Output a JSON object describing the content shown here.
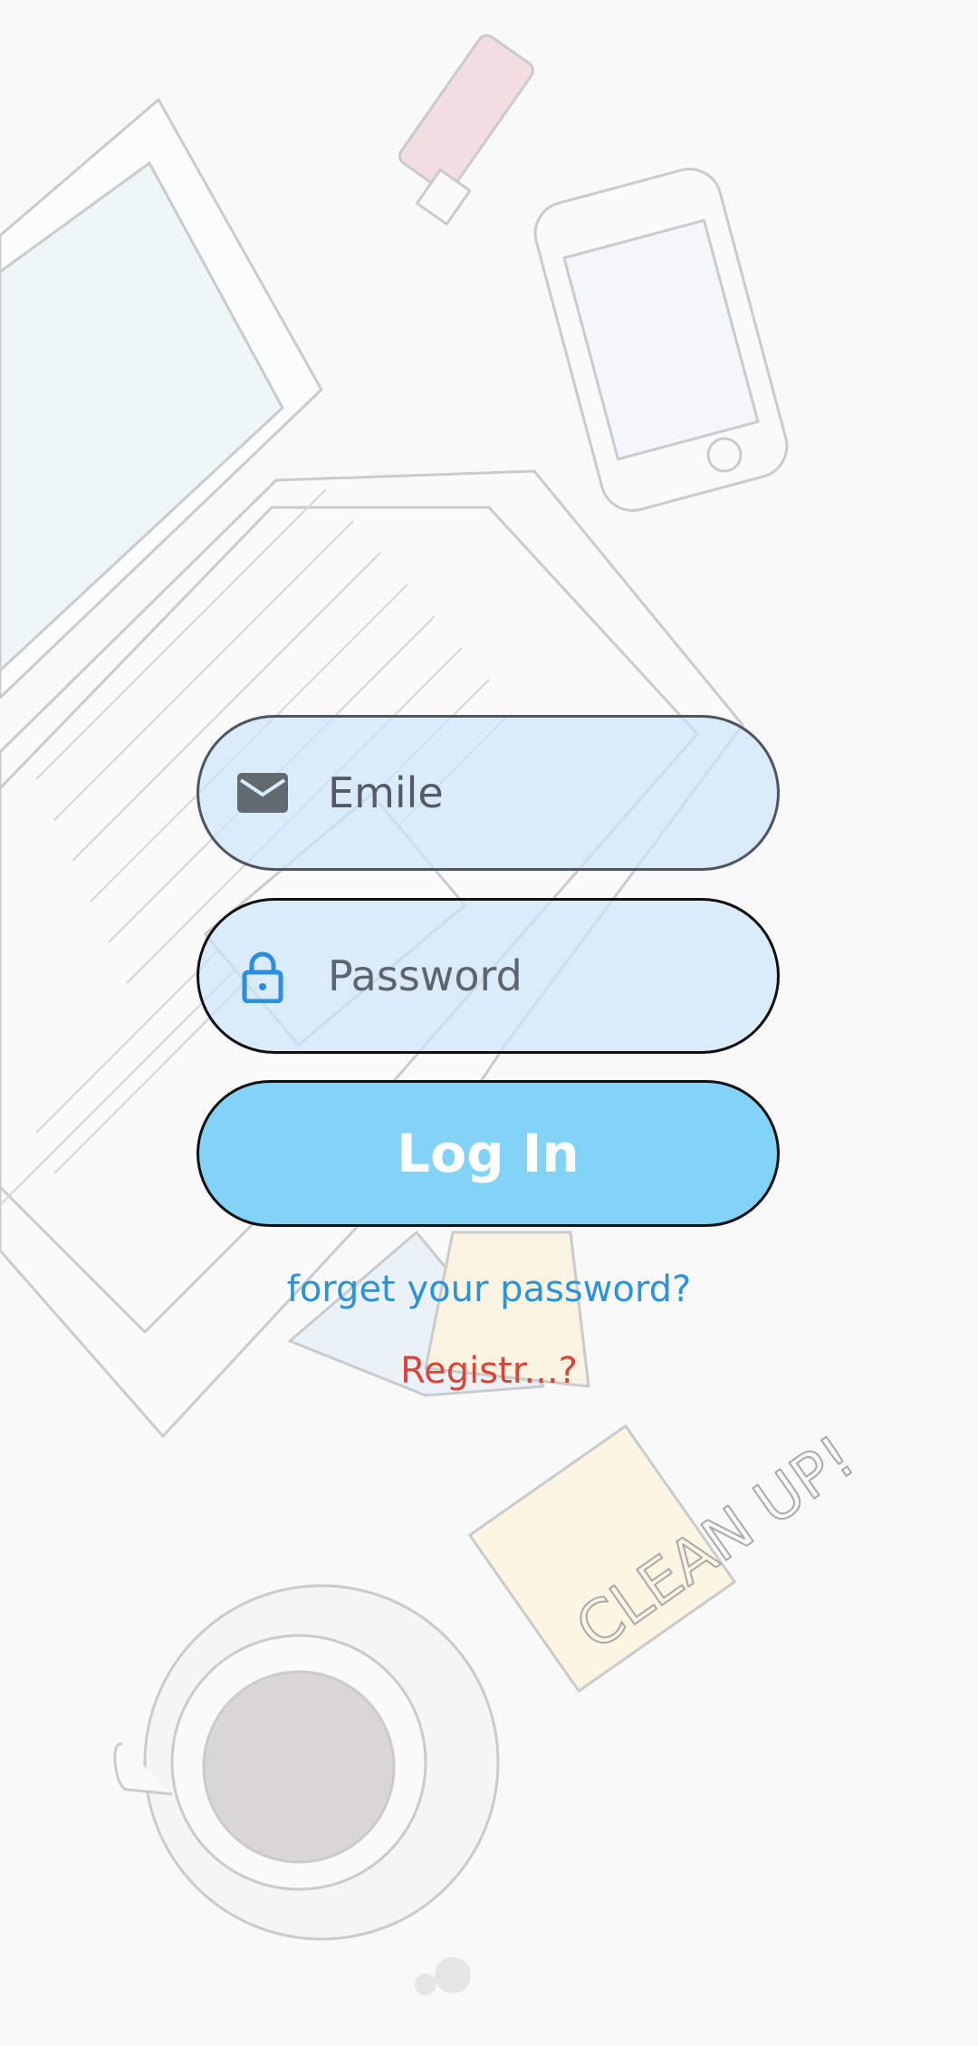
{
  "login_form": {
    "email": {
      "value": "Emile",
      "icon": "mail-icon"
    },
    "password": {
      "value": "",
      "placeholder": "Password",
      "icon": "lock-icon"
    },
    "login_button_label": "Log In",
    "forgot_password_label": "forget your password?",
    "register_label": "Registr...?"
  },
  "background": {
    "sticky_note_text": "CLEAN UP!"
  },
  "colors": {
    "field_fill": "#d9ebf9",
    "login_button": "#83d3f8",
    "forgot_link": "#2b93d8",
    "register_link": "#d8453a",
    "lock_icon": "#2b8ee0",
    "mail_icon": "#616971"
  }
}
